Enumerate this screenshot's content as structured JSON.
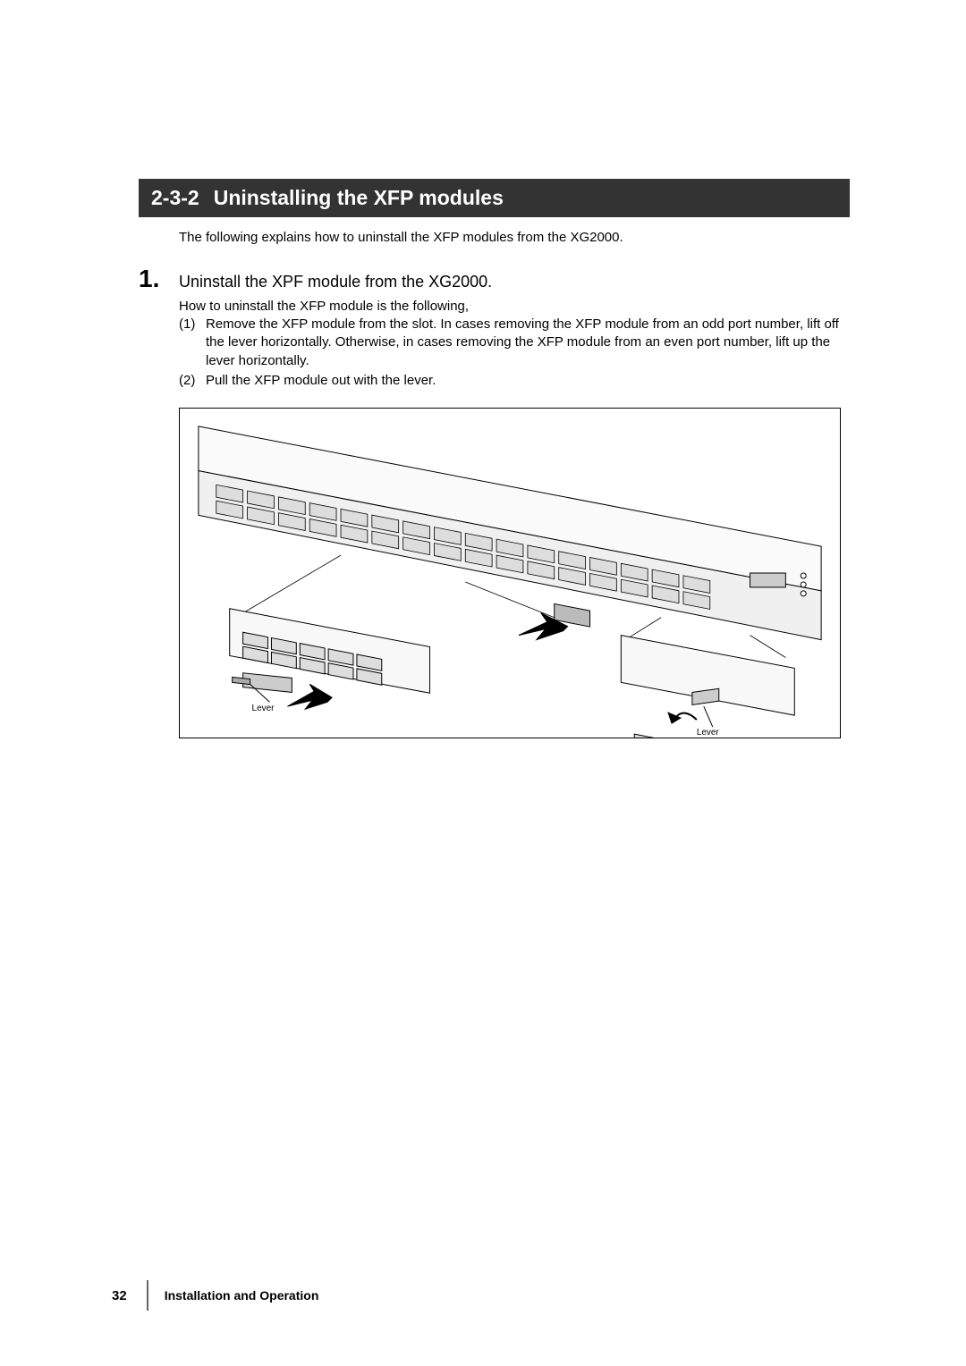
{
  "section": {
    "number": "2-3-2",
    "title": "Uninstalling the XFP modules"
  },
  "intro": "The following explains how to uninstall the XFP modules from the XG2000.",
  "step": {
    "number": "1.",
    "title": "Uninstall the XPF module from the XG2000.",
    "lead": "How to uninstall the XFP module is the following,",
    "sub1_num": "(1)",
    "sub1_text": "Remove the XFP module from the slot. In cases removing the XFP module from an odd port number, lift off the lever horizontally. Otherwise, in cases removing the XFP module from an even port number, lift up the lever horizontally.",
    "sub2_num": "(2)",
    "sub2_text": "Pull the XFP module out with the lever."
  },
  "figure": {
    "lever_label_left": "Lever",
    "lever_label_right": "Lever"
  },
  "footer": {
    "page": "32",
    "chapter": "Installation and Operation"
  }
}
